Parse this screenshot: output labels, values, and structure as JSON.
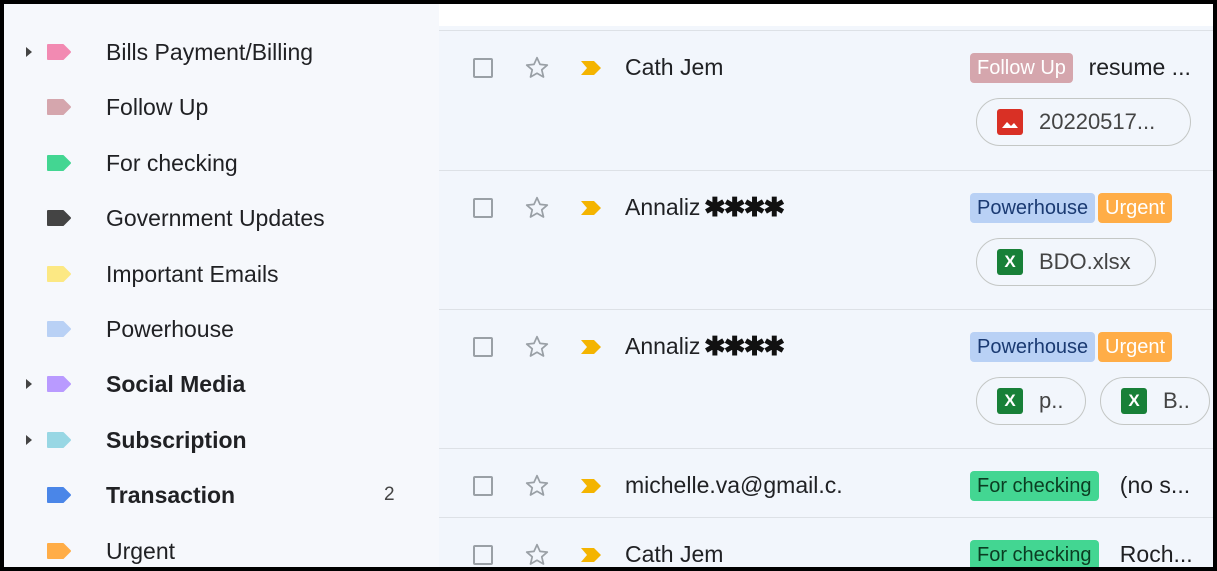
{
  "labels": [
    {
      "name": "Bills Payment/Billing",
      "color": "#f28ab2",
      "expandable": true,
      "bold": false,
      "count": ""
    },
    {
      "name": "Follow Up",
      "color": "#d5a6ad",
      "expandable": false,
      "bold": false,
      "count": ""
    },
    {
      "name": "For checking",
      "color": "#43d692",
      "expandable": false,
      "bold": false,
      "count": ""
    },
    {
      "name": "Government Updates",
      "color": "#444444",
      "expandable": false,
      "bold": false,
      "count": ""
    },
    {
      "name": "Important Emails",
      "color": "#fce883",
      "expandable": false,
      "bold": false,
      "count": ""
    },
    {
      "name": "Powerhouse",
      "color": "#b9d1f5",
      "expandable": false,
      "bold": false,
      "count": ""
    },
    {
      "name": "Social Media",
      "color": "#b99aff",
      "expandable": true,
      "bold": true,
      "count": ""
    },
    {
      "name": "Subscription",
      "color": "#98d7e4",
      "expandable": true,
      "bold": true,
      "count": ""
    },
    {
      "name": "Transaction",
      "color": "#4a86e8",
      "expandable": false,
      "bold": true,
      "count": "2"
    },
    {
      "name": "Urgent",
      "color": "#ffad47",
      "expandable": false,
      "bold": false,
      "count": ""
    }
  ],
  "emails": [
    {
      "sender": "Cath Jem",
      "redacted": false,
      "subject": "resume ...",
      "chips": [
        {
          "text": "Follow Up",
          "bg": "#d5a6ad",
          "fg": "#ffffff"
        }
      ],
      "attachments": [
        {
          "name": "20220517...",
          "type": "image-icon",
          "color": "#d93025",
          "glyph": ""
        }
      ]
    },
    {
      "sender": "Annaliz",
      "redacted": true,
      "redaction": "✱✱✱✱",
      "subject": "",
      "chips": [
        {
          "text": "Powerhouse",
          "bg": "#b9d1f5",
          "fg": "#1a3a72"
        },
        {
          "text": "Urgent",
          "bg": "#ffad47",
          "fg": "#ffffff"
        }
      ],
      "attachments": [
        {
          "name": "BDO.xlsx",
          "type": "excel-icon",
          "color": "#188038",
          "glyph": "X"
        }
      ]
    },
    {
      "sender": "Annaliz",
      "redacted": true,
      "redaction": "✱✱✱✱",
      "subject": "",
      "chips": [
        {
          "text": "Powerhouse",
          "bg": "#b9d1f5",
          "fg": "#1a3a72"
        },
        {
          "text": "Urgent",
          "bg": "#ffad47",
          "fg": "#ffffff"
        }
      ],
      "attachments": [
        {
          "name": "p..",
          "type": "excel-icon",
          "color": "#188038",
          "glyph": "X"
        },
        {
          "name": "B..",
          "type": "excel-icon",
          "color": "#188038",
          "glyph": "X"
        }
      ]
    },
    {
      "sender": "michelle.va@gmail.c.",
      "redacted": false,
      "subject": "(no s...",
      "chips": [
        {
          "text": "For checking",
          "bg": "#43d692",
          "fg": "#0b3d22"
        }
      ],
      "attachments": []
    },
    {
      "sender": "Cath Jem",
      "redacted": false,
      "subject": "Roch...",
      "chips": [
        {
          "text": "For checking",
          "bg": "#43d692",
          "fg": "#0b3d22"
        }
      ],
      "attachments": []
    }
  ]
}
